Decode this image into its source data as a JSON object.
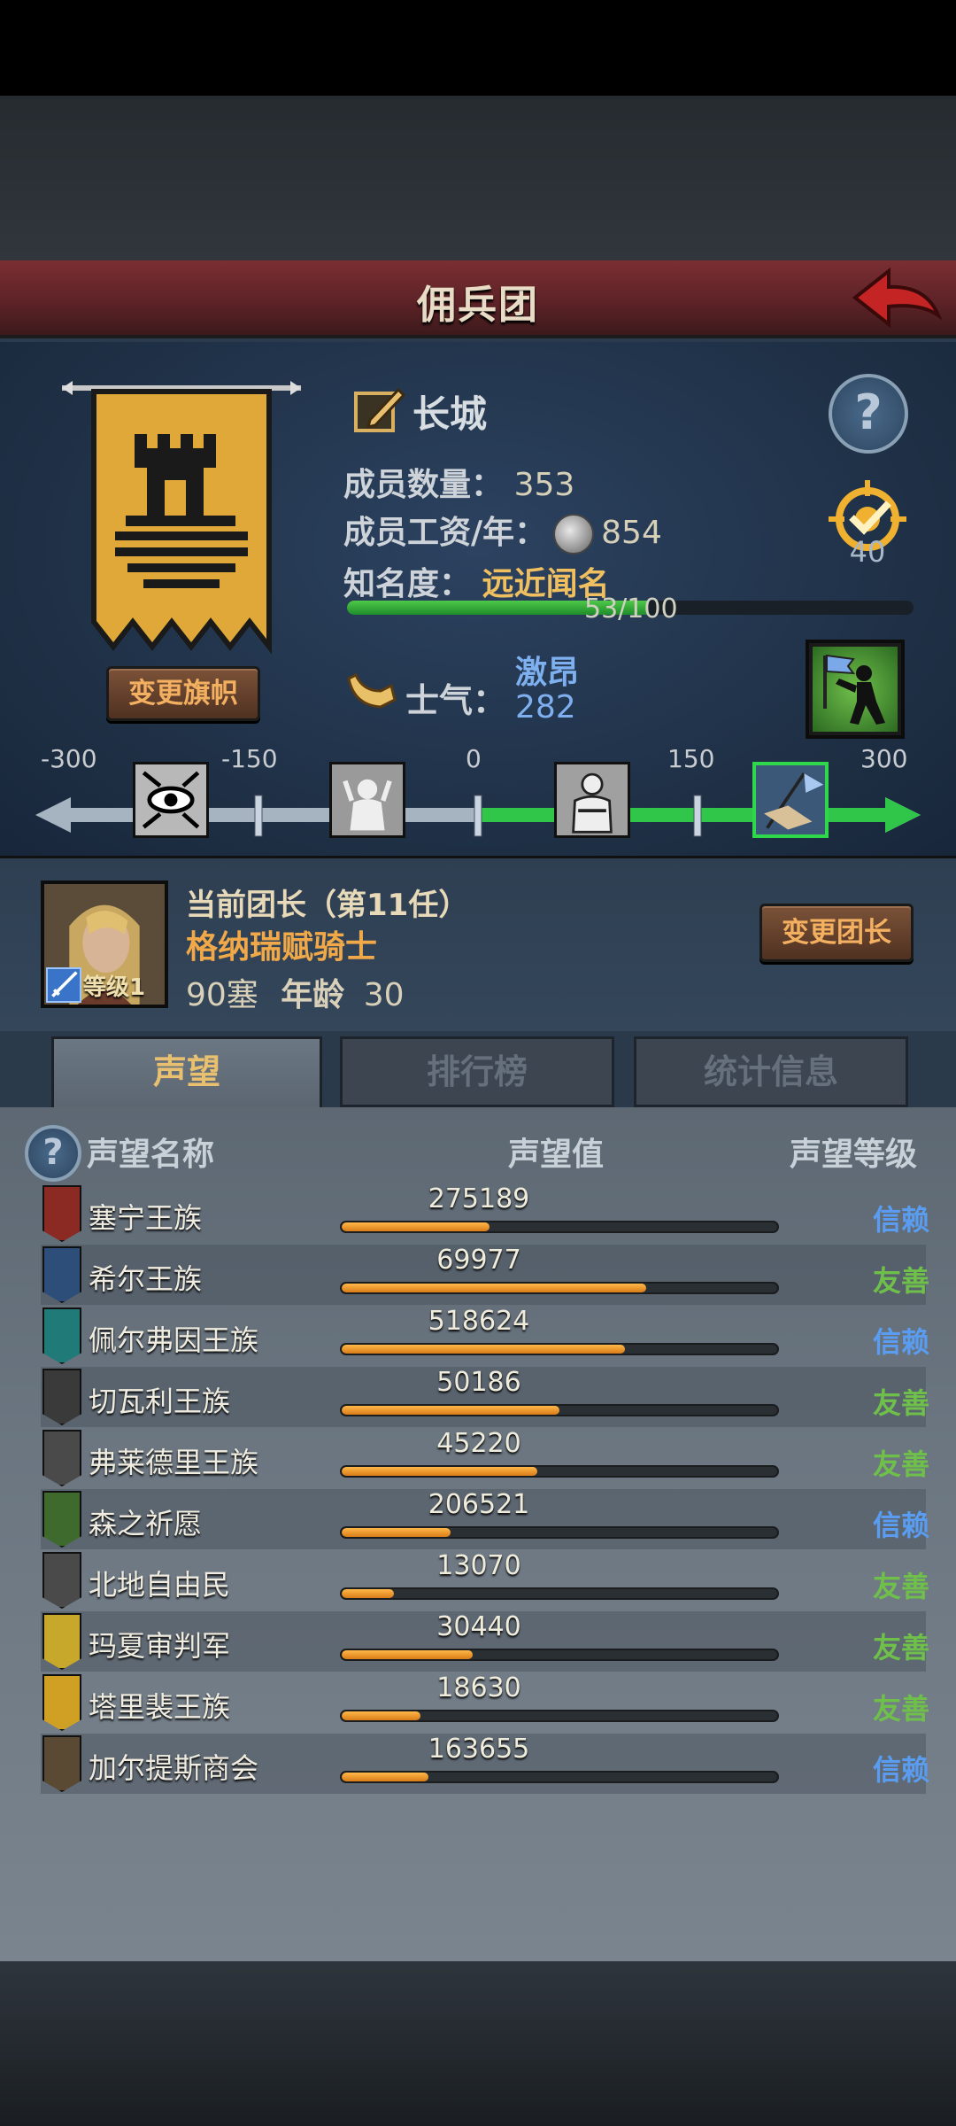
{
  "header": {
    "title": "佣兵团"
  },
  "legion": {
    "name": "长城",
    "members_label": "成员数量：",
    "members_value": "353",
    "salary_label": "成员工资/年：",
    "salary_value": "854",
    "fame_label": "知名度：",
    "fame_value": "远近闻名",
    "fame_progress_text": "53/100",
    "fame_progress": 0.53,
    "target_value": "40",
    "change_banner_label": "变更旗帜"
  },
  "morale": {
    "label": "士气：",
    "state": "激昂",
    "value": "282",
    "scale_labels": [
      "-300",
      "-150",
      "0",
      "150",
      "300"
    ]
  },
  "leader": {
    "title": "当前团长（第11任）",
    "name": "格纳瑞赋骑士",
    "origin": "90塞",
    "age_label": "年龄",
    "age_value": "30",
    "level_label": "等级1",
    "change_leader_label": "变更团长"
  },
  "tabs": [
    "声望",
    "排行榜",
    "统计信息"
  ],
  "table": {
    "headers": [
      "声望名称",
      "声望值",
      "声望等级"
    ],
    "rows": [
      {
        "name": "塞宁王族",
        "value": "275189",
        "level": "信赖",
        "fill": 0.34,
        "color": "#8a2a22"
      },
      {
        "name": "希尔王族",
        "value": "69977",
        "level": "友善",
        "fill": 0.7,
        "color": "#2c4e78"
      },
      {
        "name": "佩尔弗因王族",
        "value": "518624",
        "level": "信赖",
        "fill": 0.65,
        "color": "#1f7a78"
      },
      {
        "name": "切瓦利王族",
        "value": "50186",
        "level": "友善",
        "fill": 0.5,
        "color": "#3a3a3a"
      },
      {
        "name": "弗莱德里王族",
        "value": "45220",
        "level": "友善",
        "fill": 0.45,
        "color": "#4a4a4a"
      },
      {
        "name": "森之祈愿",
        "value": "206521",
        "level": "信赖",
        "fill": 0.25,
        "color": "#3e6a2e"
      },
      {
        "name": "北地自由民",
        "value": "13070",
        "level": "友善",
        "fill": 0.12,
        "color": "#4a4a4a"
      },
      {
        "name": "玛夏审判军",
        "value": "30440",
        "level": "友善",
        "fill": 0.3,
        "color": "#c8a82a"
      },
      {
        "name": "塔里裴王族",
        "value": "18630",
        "level": "友善",
        "fill": 0.18,
        "color": "#d0a024"
      },
      {
        "name": "加尔提斯商会",
        "value": "163655",
        "level": "信赖",
        "fill": 0.2,
        "color": "#5a4a34"
      }
    ]
  }
}
